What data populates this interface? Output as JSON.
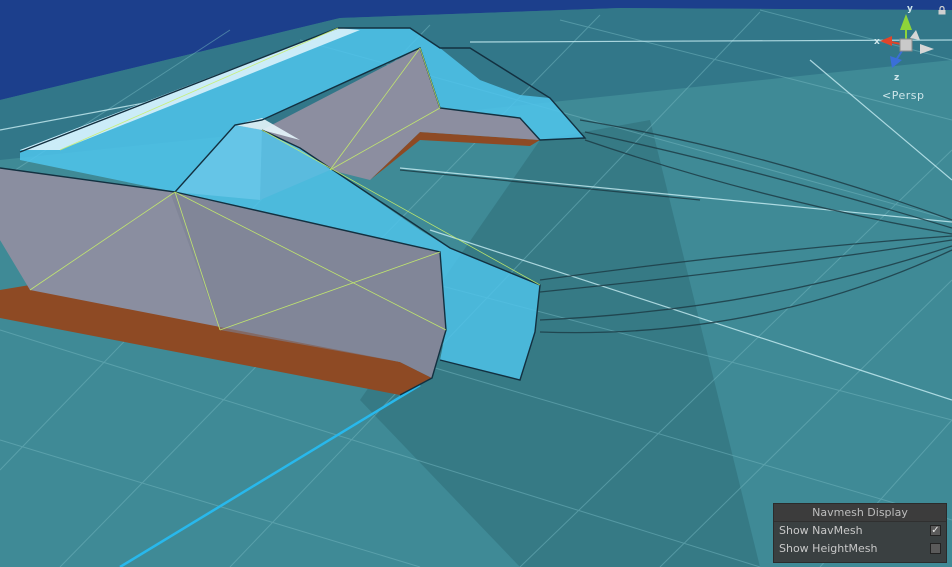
{
  "scene_view": {
    "projection_label": "Persp",
    "gizmo": {
      "x_label": "x",
      "y_label": "y",
      "z_label": "z",
      "x_color": "#e0452a",
      "y_color": "#8ed43a",
      "z_color": "#3a6fd8"
    },
    "colors": {
      "ground": "#3f8a96",
      "sky": "#1c3f8c",
      "navmesh": "#4fc4ec",
      "wall": "#8a8ea0",
      "orange_base": "#8e4a24"
    }
  },
  "navmesh_display": {
    "title": "Navmesh Display",
    "show_navmesh_label": "Show NavMesh",
    "show_navmesh_checked": true,
    "show_navmesh_mark": "✓",
    "show_heightmesh_label": "Show HeightMesh",
    "show_heightmesh_checked": false,
    "show_heightmesh_mark": ""
  }
}
